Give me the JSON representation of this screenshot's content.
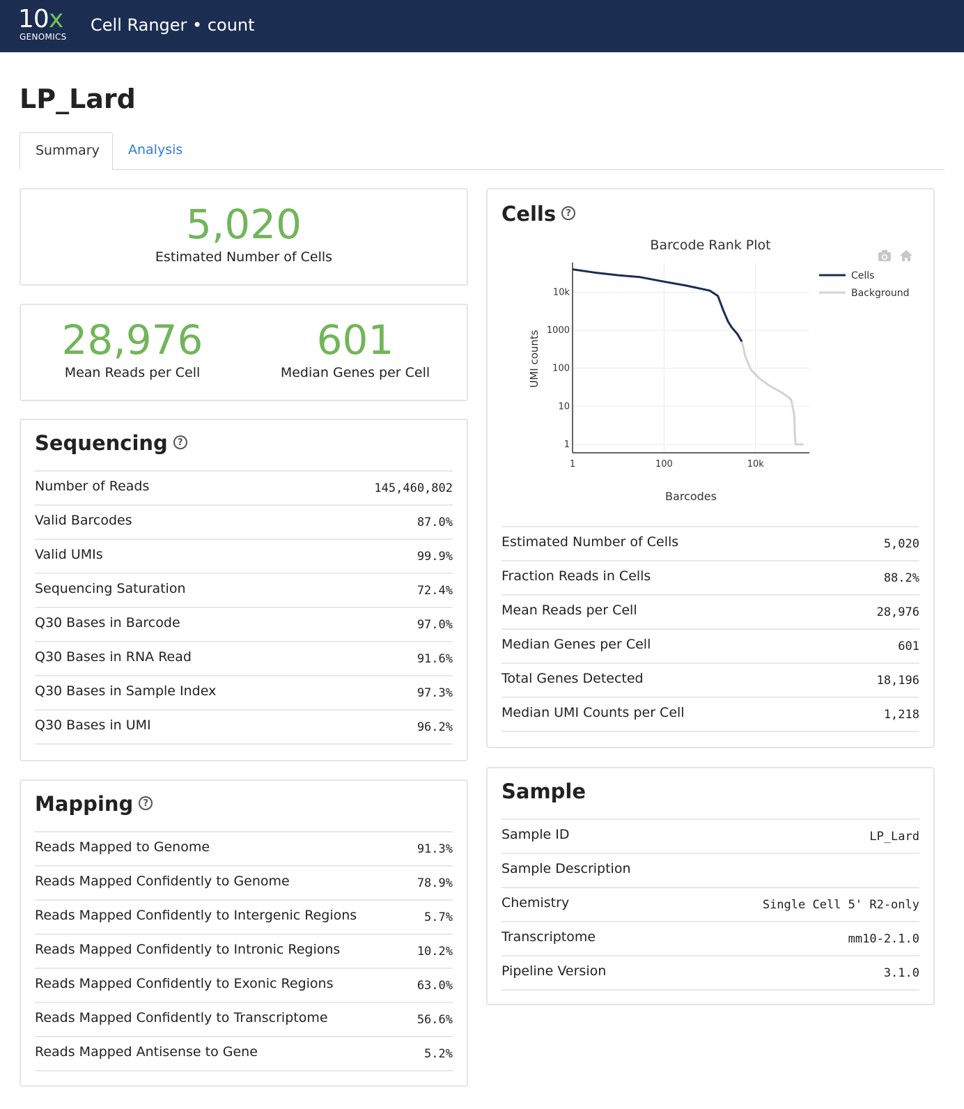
{
  "header": {
    "logo_number": "10",
    "logo_x": "x",
    "logo_word": "GENOMICS",
    "app_title": "Cell Ranger • count"
  },
  "page_title": "LP_Lard",
  "tabs": [
    {
      "label": "Summary",
      "active": true
    },
    {
      "label": "Analysis",
      "active": false
    }
  ],
  "hero": {
    "cells_value": "5,020",
    "cells_label": "Estimated Number of Cells",
    "mean_reads_value": "28,976",
    "mean_reads_label": "Mean Reads per Cell",
    "median_genes_value": "601",
    "median_genes_label": "Median Genes per Cell"
  },
  "sequencing": {
    "title": "Sequencing",
    "help_icon": "question-circle-icon",
    "rows": [
      {
        "label": "Number of Reads",
        "value": "145,460,802"
      },
      {
        "label": "Valid Barcodes",
        "value": "87.0%"
      },
      {
        "label": "Valid UMIs",
        "value": "99.9%"
      },
      {
        "label": "Sequencing Saturation",
        "value": "72.4%"
      },
      {
        "label": "Q30 Bases in Barcode",
        "value": "97.0%"
      },
      {
        "label": "Q30 Bases in RNA Read",
        "value": "91.6%"
      },
      {
        "label": "Q30 Bases in Sample Index",
        "value": "97.3%"
      },
      {
        "label": "Q30 Bases in UMI",
        "value": "96.2%"
      }
    ]
  },
  "mapping": {
    "title": "Mapping",
    "help_icon": "question-circle-icon",
    "rows": [
      {
        "label": "Reads Mapped to Genome",
        "value": "91.3%"
      },
      {
        "label": "Reads Mapped Confidently to Genome",
        "value": "78.9%"
      },
      {
        "label": "Reads Mapped Confidently to Intergenic Regions",
        "value": "5.7%"
      },
      {
        "label": "Reads Mapped Confidently to Intronic Regions",
        "value": "10.2%"
      },
      {
        "label": "Reads Mapped Confidently to Exonic Regions",
        "value": "63.0%"
      },
      {
        "label": "Reads Mapped Confidently to Transcriptome",
        "value": "56.6%"
      },
      {
        "label": "Reads Mapped Antisense to Gene",
        "value": "5.2%"
      }
    ]
  },
  "cells": {
    "title": "Cells",
    "help_icon": "question-circle-icon",
    "toolbar_icons": [
      "camera-icon",
      "home-icon"
    ],
    "rows": [
      {
        "label": "Estimated Number of Cells",
        "value": "5,020"
      },
      {
        "label": "Fraction Reads in Cells",
        "value": "88.2%"
      },
      {
        "label": "Mean Reads per Cell",
        "value": "28,976"
      },
      {
        "label": "Median Genes per Cell",
        "value": "601"
      },
      {
        "label": "Total Genes Detected",
        "value": "18,196"
      },
      {
        "label": "Median UMI Counts per Cell",
        "value": "1,218"
      }
    ]
  },
  "sample": {
    "title": "Sample",
    "rows": [
      {
        "label": "Sample ID",
        "value": "LP_Lard"
      },
      {
        "label": "Sample Description",
        "value": ""
      },
      {
        "label": "Chemistry",
        "value": "Single Cell 5' R2-only"
      },
      {
        "label": "Transcriptome",
        "value": "mm10-2.1.0"
      },
      {
        "label": "Pipeline Version",
        "value": "3.1.0"
      }
    ]
  },
  "chart_data": {
    "type": "line",
    "title": "Barcode Rank Plot",
    "xlabel": "Barcodes",
    "ylabel": "UMI counts",
    "x_scale": "log",
    "y_scale": "log",
    "xlim": [
      1,
      150000
    ],
    "ylim": [
      0.6,
      60000
    ],
    "x_ticks": [
      {
        "value": 1,
        "label": "1"
      },
      {
        "value": 100,
        "label": "100"
      },
      {
        "value": 10000,
        "label": "10k"
      }
    ],
    "y_ticks": [
      {
        "value": 1,
        "label": "1"
      },
      {
        "value": 10,
        "label": "10"
      },
      {
        "value": 100,
        "label": "100"
      },
      {
        "value": 1000,
        "label": "1000"
      },
      {
        "value": 10000,
        "label": "10k"
      }
    ],
    "grid": true,
    "legend_position": "top-right",
    "series": [
      {
        "name": "Cells",
        "color": "#1c2d52",
        "x": [
          1,
          3,
          10,
          30,
          100,
          300,
          1000,
          1500,
          2000,
          2500,
          3000,
          4000,
          5020
        ],
        "y": [
          40000,
          33000,
          28000,
          25000,
          19000,
          15000,
          11000,
          8000,
          3200,
          1700,
          1200,
          800,
          500
        ]
      },
      {
        "name": "Background",
        "color": "#d3d3d3",
        "x": [
          5020,
          6000,
          8000,
          12000,
          20000,
          40000,
          60000,
          70000,
          72000,
          75000,
          90000,
          110000
        ],
        "y": [
          500,
          200,
          90,
          55,
          35,
          22,
          15,
          6,
          2,
          1,
          1,
          1
        ]
      }
    ]
  }
}
